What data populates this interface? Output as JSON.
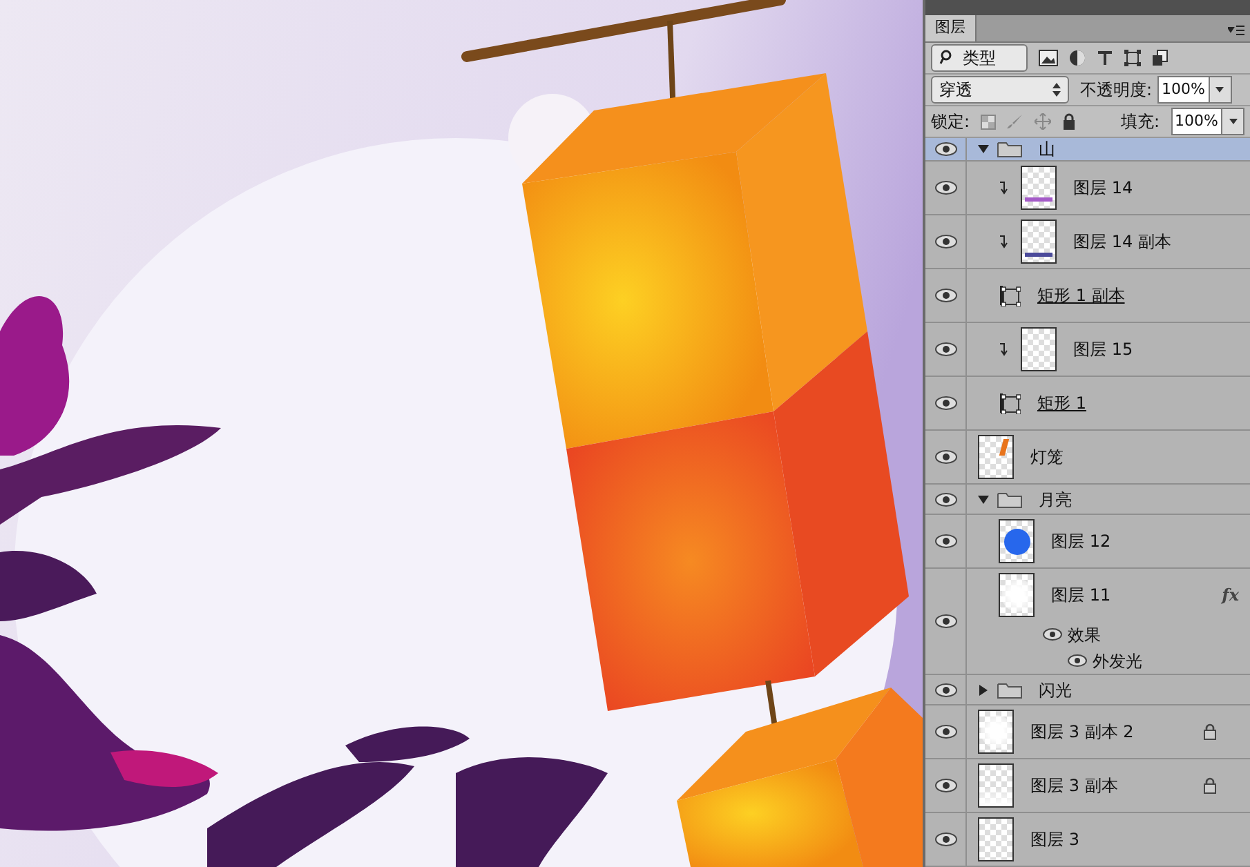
{
  "panel": {
    "tab": "图层",
    "filter_label": "类型",
    "blend_mode": "穿透",
    "opacity_label": "不透明度:",
    "opacity": "100%",
    "lock_label": "锁定:",
    "fill_label": "填充:",
    "fill": "100%"
  },
  "layers": [
    {
      "kind": "group",
      "name": "山",
      "visible": true,
      "selected": true,
      "expanded": true,
      "children": [
        {
          "kind": "pixel",
          "name": "图层 14",
          "visible": true,
          "selected": false,
          "clipped": true,
          "locked": false,
          "thumbnail": {
            "kind": "stroke-purple"
          }
        },
        {
          "kind": "pixel",
          "name": "图层 14 副本",
          "visible": true,
          "selected": false,
          "clipped": true,
          "locked": false,
          "thumbnail": {
            "kind": "stroke-navy"
          }
        },
        {
          "kind": "shape",
          "name": "矩形 1 副本",
          "visible": true,
          "selected": false,
          "clipped": false,
          "locked": false
        },
        {
          "kind": "pixel",
          "name": "图层 15",
          "visible": true,
          "selected": false,
          "clipped": true,
          "locked": false,
          "thumbnail": {
            "kind": "blank"
          }
        },
        {
          "kind": "shape",
          "name": "矩形 1",
          "visible": true,
          "selected": false,
          "clipped": false,
          "locked": false
        }
      ]
    },
    {
      "kind": "pixel",
      "name": "灯笼",
      "visible": true,
      "selected": false,
      "clipped": false,
      "locked": false,
      "thumbnail": {
        "kind": "lantern"
      }
    },
    {
      "kind": "group",
      "name": "月亮",
      "visible": true,
      "selected": false,
      "expanded": true,
      "children": [
        {
          "kind": "pixel",
          "name": "图层 12",
          "visible": true,
          "selected": false,
          "clipped": false,
          "locked": false,
          "thumbnail": {
            "kind": "circle"
          }
        },
        {
          "kind": "pixel",
          "name": "图层 11",
          "visible": true,
          "selected": false,
          "clipped": false,
          "locked": false,
          "thumbnail": {
            "kind": "glow"
          },
          "fx_label": "fx",
          "effects": {
            "label": "效果",
            "visible": true,
            "items": [
              {
                "name": "外发光",
                "visible": true
              }
            ]
          }
        }
      ]
    },
    {
      "kind": "group",
      "name": "闪光",
      "visible": true,
      "selected": false,
      "expanded": false
    },
    {
      "kind": "pixel",
      "name": "图层 3 副本 2",
      "visible": true,
      "selected": false,
      "clipped": false,
      "locked": true,
      "thumbnail": {
        "kind": "glow"
      }
    },
    {
      "kind": "pixel",
      "name": "图层 3 副本",
      "visible": true,
      "selected": false,
      "clipped": false,
      "locked": true,
      "thumbnail": {
        "kind": "fade"
      }
    },
    {
      "kind": "pixel",
      "name": "图层 3",
      "visible": true,
      "selected": false,
      "clipped": false,
      "locked": false,
      "thumbnail": {
        "kind": "blank"
      }
    }
  ]
}
